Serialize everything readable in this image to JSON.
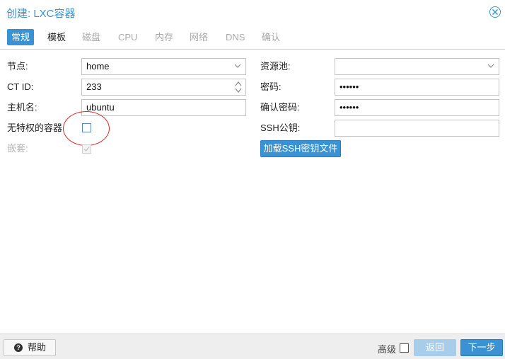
{
  "dialog": {
    "title": "创建: LXC容器"
  },
  "tabs": [
    {
      "label": "常规",
      "state": "active"
    },
    {
      "label": "模板",
      "state": "enabled"
    },
    {
      "label": "磁盘",
      "state": "disabled"
    },
    {
      "label": "CPU",
      "state": "disabled"
    },
    {
      "label": "内存",
      "state": "disabled"
    },
    {
      "label": "网络",
      "state": "disabled"
    },
    {
      "label": "DNS",
      "state": "disabled"
    },
    {
      "label": "确认",
      "state": "disabled"
    }
  ],
  "left": {
    "node_label": "节点:",
    "node_value": "home",
    "ctid_label": "CT ID:",
    "ctid_value": "233",
    "hostname_label": "主机名:",
    "hostname_value": "ubuntu",
    "unprivileged_label": "无特权的容器",
    "unprivileged_checked": false,
    "nesting_label": "嵌套:",
    "nesting_checked": true
  },
  "right": {
    "pool_label": "资源池:",
    "pool_value": "",
    "password_label": "密码:",
    "password_value": "••••••",
    "confirm_label": "确认密码:",
    "confirm_value": "••••••",
    "ssh_label": "SSH公钥:",
    "ssh_value": "",
    "load_ssh_button": "加载SSH密钥文件"
  },
  "footer": {
    "help_button": "帮助",
    "advanced_label": "高级",
    "advanced_checked": false,
    "back_button": "返回",
    "next_button": "下一步"
  },
  "colors": {
    "accent": "#3892d4",
    "annotation": "#d42b2b"
  }
}
